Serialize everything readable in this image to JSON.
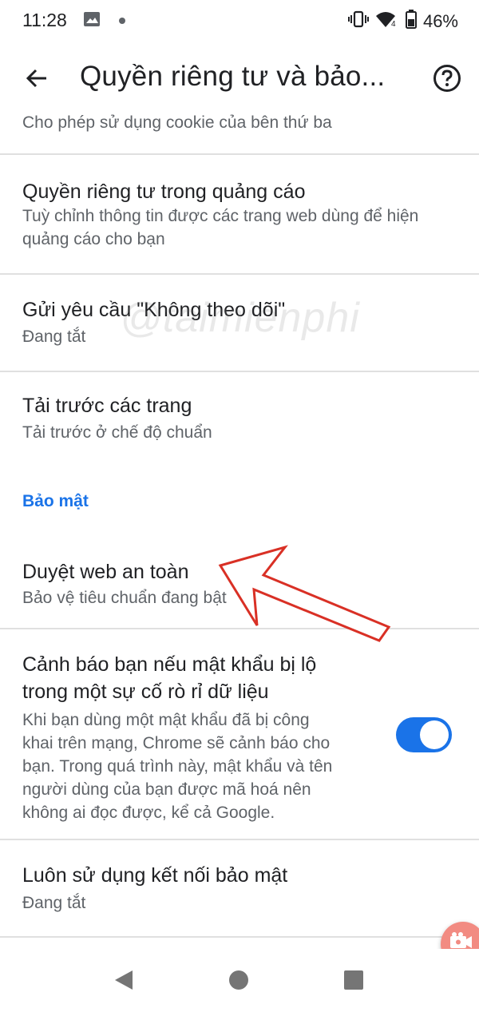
{
  "status_bar": {
    "time": "11:28",
    "left_icons": [
      "image-icon",
      "notification-dot-icon"
    ],
    "right_icons": [
      "vibrate-icon",
      "wifi-icon",
      "battery-icon"
    ],
    "battery": "46%"
  },
  "app_bar": {
    "back_icon": "arrow-left-icon",
    "title": "Quyền riêng tư và bảo...",
    "help_icon": "help-circle-icon"
  },
  "settings": {
    "partial_row_sub": "Cho phép sử dụng cookie của bên thứ ba",
    "ad_privacy": {
      "title": "Quyền riêng tư trong quảng cáo",
      "subtitle_line1": "Tuỳ chỉnh thông tin được các trang web dùng để hiện",
      "subtitle_line2": "quảng cáo cho bạn"
    },
    "do_not_track": {
      "title": "Gửi yêu cầu \"Không theo dõi\"",
      "subtitle": "Đang tắt"
    },
    "preload": {
      "title": "Tải trước các trang",
      "subtitle": "Tải trước ở chế độ chuẩn"
    },
    "security_header": "Bảo mật",
    "safe_browsing": {
      "title": "Duyệt web an toàn",
      "subtitle": "Bảo vệ tiêu chuẩn đang bật"
    },
    "password_leak": {
      "title_line1": "Cảnh báo bạn nếu mật khẩu bị lộ",
      "title_line2": "trong một sự cố rò rỉ dữ liệu",
      "desc_line1": "Khi bạn dùng một mật khẩu đã bị công",
      "desc_line2": "khai trên mạng, Chrome sẽ cảnh báo cho",
      "desc_line3": "bạn. Trong quá trình này, mật khẩu và tên",
      "desc_line4": "người dùng của bạn được mã hoá nên",
      "desc_line5": "không ai đọc được, kể cả Google.",
      "toggle_on": true
    },
    "secure_connection": {
      "title": "Luôn sử dụng kết nối bảo mật",
      "subtitle": "Đang tắt"
    }
  },
  "watermark": "@taimienphi",
  "floating_button_icon": "screen-record-icon",
  "nav_bar": {
    "icons": [
      "back-triangle-icon",
      "home-circle-icon",
      "recents-square-icon"
    ]
  },
  "colors": {
    "accent": "#1a73e8",
    "divider": "#e0e0e0",
    "annotation_arrow": "#d93025",
    "floating_button": "#f28b82"
  }
}
